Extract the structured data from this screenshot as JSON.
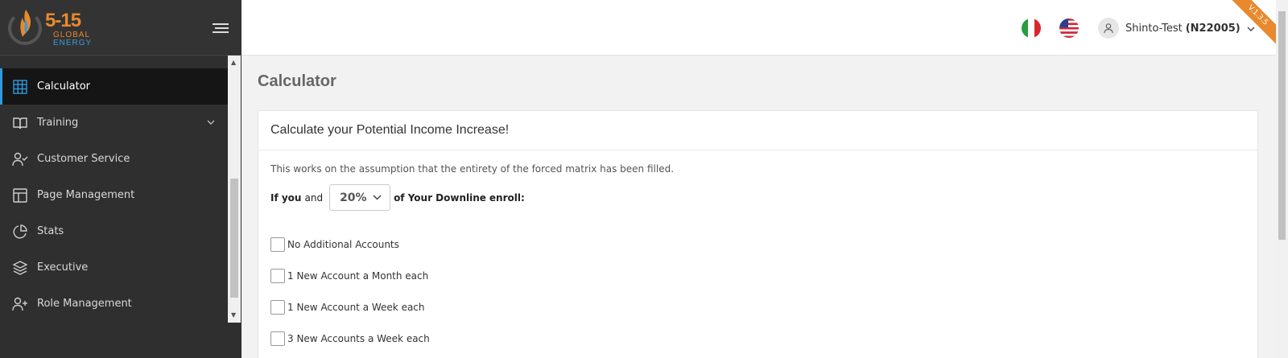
{
  "brand": {
    "logo_number": "5-15",
    "logo_line1": "GLOBAL",
    "logo_line2": "ENERGY"
  },
  "sidebar": {
    "items": [
      {
        "label": "Calculator",
        "icon": "calculator-icon",
        "active": true
      },
      {
        "label": "Training",
        "icon": "book-icon",
        "has_submenu": true
      },
      {
        "label": "Customer Service",
        "icon": "user-check-icon"
      },
      {
        "label": "Page Management",
        "icon": "layout-icon"
      },
      {
        "label": "Stats",
        "icon": "pie-chart-icon"
      },
      {
        "label": "Executive",
        "icon": "layers-icon"
      },
      {
        "label": "Role Management",
        "icon": "user-plus-icon"
      }
    ],
    "scroll_up": "▲",
    "scroll_down": "▼"
  },
  "header": {
    "user_name": "Shinto-Test",
    "user_id": "(N22005)",
    "version": "V.1.3.5"
  },
  "main": {
    "page_title": "Calculator",
    "card_title": "Calculate your Potential Income Increase!",
    "description": "This works on the assumption that the entirety of the forced matrix has been filled.",
    "enroll_prefix_bold": "If you",
    "enroll_prefix": "and",
    "enroll_percent": "20%",
    "enroll_suffix_pre": "of Your Downline",
    "enroll_suffix_bold": "enroll:",
    "options": [
      "No Additional Accounts",
      "1 New Account a Month each",
      "1 New Account a Week each",
      "3 New Accounts a Week each"
    ]
  },
  "colors": {
    "accent": "#e8892e",
    "active_bar": "#2d9be0",
    "sidebar_bg": "#2f2f2f"
  }
}
